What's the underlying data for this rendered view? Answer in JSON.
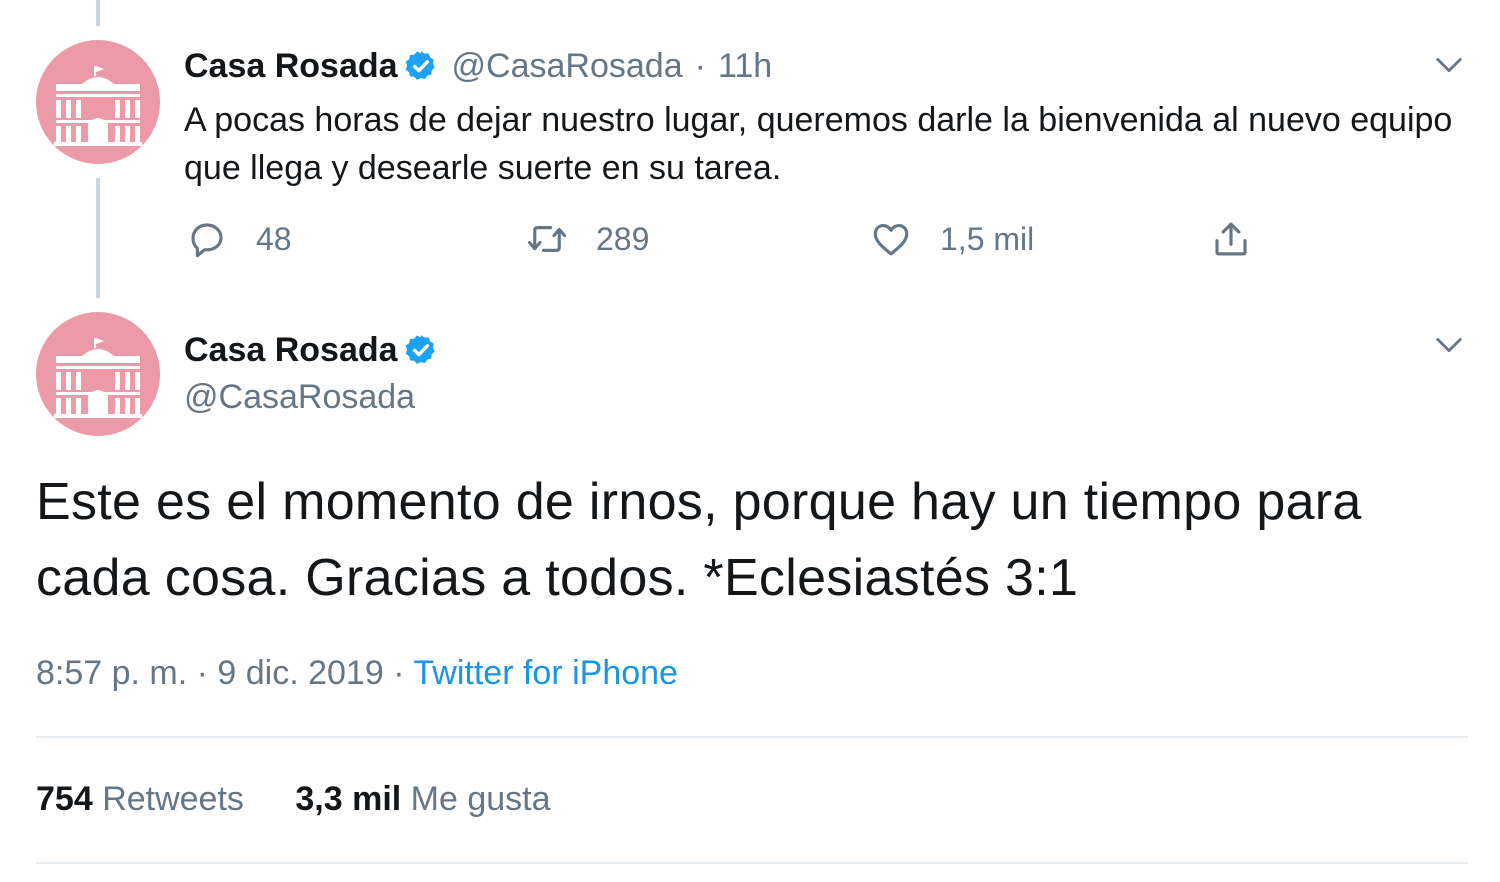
{
  "colors": {
    "avatar_bg": "#ec9aa8",
    "verified": "#1da1f2",
    "link": "#1b95e0",
    "muted": "#657786"
  },
  "icons": [
    "building-logo-icon",
    "verified-badge-icon",
    "chevron-down-icon",
    "reply-icon",
    "retweet-icon",
    "like-icon",
    "share-icon"
  ],
  "reply_tweet": {
    "display_name": "Casa Rosada",
    "handle": "@CasaRosada",
    "separator": "·",
    "time": "11h",
    "text": "A pocas horas de dejar nuestro lugar, queremos darle la bienvenida al nuevo equipo que llega y desearle suerte en su tarea.",
    "actions": {
      "replies": "48",
      "retweets": "289",
      "likes": "1,5 mil"
    }
  },
  "main_tweet": {
    "display_name": "Casa Rosada",
    "handle": "@CasaRosada",
    "text": "Este es el momento de irnos, porque hay un tiempo para cada cosa. Gracias a todos. *Eclesiastés 3:1",
    "timestamp": "8:57 p. m. · 9 dic. 2019",
    "meta_sep": "·",
    "source": "Twitter for iPhone",
    "stats": {
      "retweets_count": "754",
      "retweets_label": "Retweets",
      "likes_count": "3,3 mil",
      "likes_label": "Me gusta"
    }
  }
}
